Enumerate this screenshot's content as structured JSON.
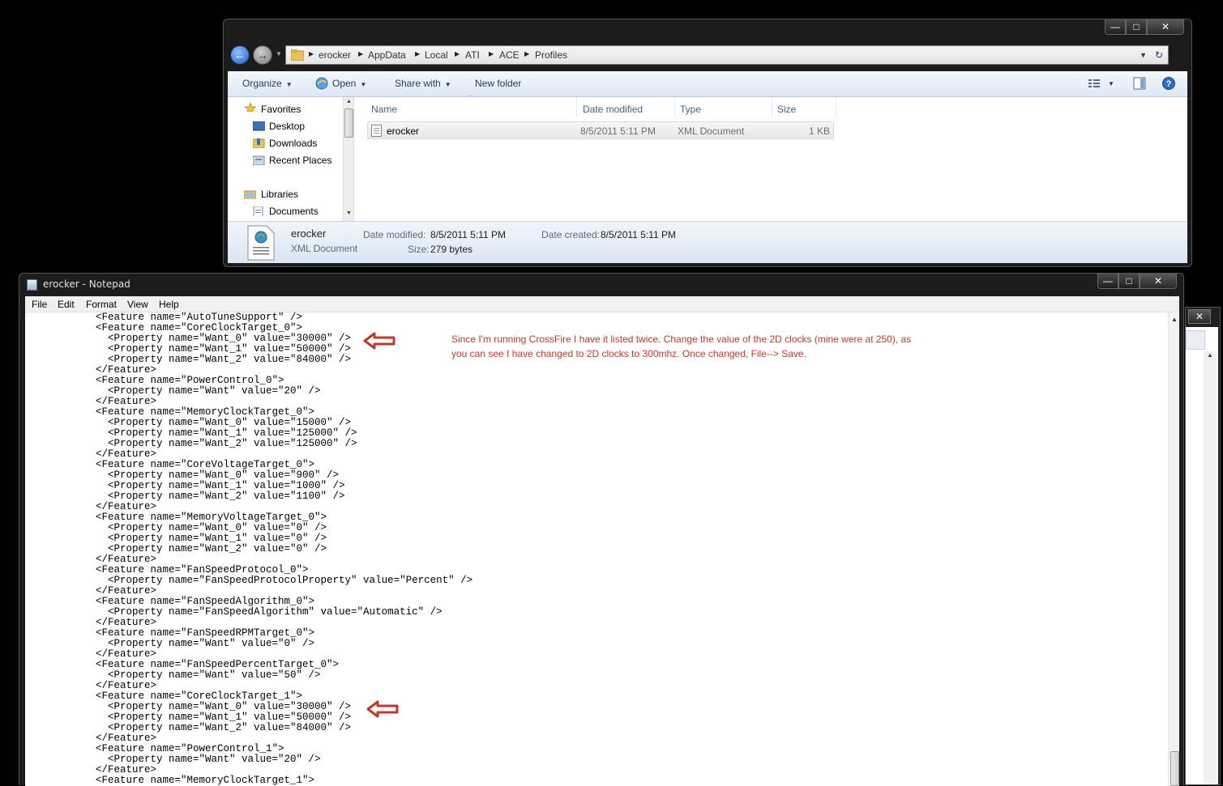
{
  "explorer": {
    "breadcrumb": [
      "erocker",
      "AppData",
      "Local",
      "ATI",
      "ACE",
      "Profiles"
    ],
    "toolbar": {
      "organize": "Organize",
      "open": "Open",
      "share_with": "Share with",
      "new_folder": "New folder"
    },
    "nav": {
      "favorites": "Favorites",
      "desktop": "Desktop",
      "downloads": "Downloads",
      "recent_places": "Recent Places",
      "libraries": "Libraries",
      "documents": "Documents"
    },
    "columns": {
      "name": "Name",
      "date_modified": "Date modified",
      "type": "Type",
      "size": "Size"
    },
    "file": {
      "name": "erocker",
      "date_modified": "8/5/2011 5:11 PM",
      "type": "XML Document",
      "size": "1 KB"
    },
    "details": {
      "name": "erocker",
      "type": "XML Document",
      "date_modified_label": "Date modified:",
      "date_modified": "8/5/2011 5:11 PM",
      "date_created_label": "Date created:",
      "date_created": "8/5/2011 5:11 PM",
      "size_label": "Size:",
      "size": "279 bytes"
    }
  },
  "notepad": {
    "title": "erocker - Notepad",
    "menu": {
      "file": "File",
      "edit": "Edit",
      "format": "Format",
      "view": "View",
      "help": "Help"
    },
    "content": "      <Feature name=\"AutoTuneSupport\" />\n      <Feature name=\"CoreClockTarget_0\">\n        <Property name=\"Want_0\" value=\"30000\" />\n        <Property name=\"Want_1\" value=\"50000\" />\n        <Property name=\"Want_2\" value=\"84000\" />\n      </Feature>\n      <Feature name=\"PowerControl_0\">\n        <Property name=\"Want\" value=\"20\" />\n      </Feature>\n      <Feature name=\"MemoryClockTarget_0\">\n        <Property name=\"Want_0\" value=\"15000\" />\n        <Property name=\"Want_1\" value=\"125000\" />\n        <Property name=\"Want_2\" value=\"125000\" />\n      </Feature>\n      <Feature name=\"CoreVoltageTarget_0\">\n        <Property name=\"Want_0\" value=\"900\" />\n        <Property name=\"Want_1\" value=\"1000\" />\n        <Property name=\"Want_2\" value=\"1100\" />\n      </Feature>\n      <Feature name=\"MemoryVoltageTarget_0\">\n        <Property name=\"Want_0\" value=\"0\" />\n        <Property name=\"Want_1\" value=\"0\" />\n        <Property name=\"Want_2\" value=\"0\" />\n      </Feature>\n      <Feature name=\"FanSpeedProtocol_0\">\n        <Property name=\"FanSpeedProtocolProperty\" value=\"Percent\" />\n      </Feature>\n      <Feature name=\"FanSpeedAlgorithm_0\">\n        <Property name=\"FanSpeedAlgorithm\" value=\"Automatic\" />\n      </Feature>\n      <Feature name=\"FanSpeedRPMTarget_0\">\n        <Property name=\"Want\" value=\"0\" />\n      </Feature>\n      <Feature name=\"FanSpeedPercentTarget_0\">\n        <Property name=\"Want\" value=\"50\" />\n      </Feature>\n      <Feature name=\"CoreClockTarget_1\">\n        <Property name=\"Want_0\" value=\"30000\" />\n        <Property name=\"Want_1\" value=\"50000\" />\n        <Property name=\"Want_2\" value=\"84000\" />\n      </Feature>\n      <Feature name=\"PowerControl_1\">\n        <Property name=\"Want\" value=\"20\" />\n      </Feature>\n      <Feature name=\"MemoryClockTarget_1\">"
  },
  "annotation": {
    "text": "Since I'm running CrossFire I have it listed twice. Change the value of the 2D clocks (mine were at 250), as you can see I have changed to 2D clocks to 300mhz. Once changed, File--> Save.",
    "color": "#c0392b"
  },
  "icons": {
    "back": "back-arrow-icon",
    "forward": "forward-arrow-icon",
    "folder": "folder-icon",
    "refresh": "refresh-icon",
    "help": "help-icon",
    "xml_file": "xml-file-icon",
    "annotation_arrow": "red-left-arrow-icon"
  }
}
